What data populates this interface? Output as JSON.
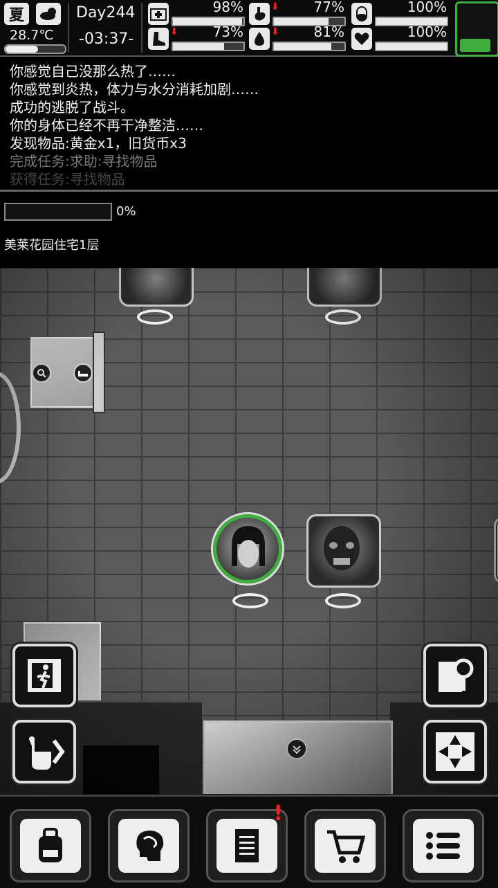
{
  "hud": {
    "season": "夏",
    "temperature": "28.7℃",
    "temperature_level": 0.55,
    "day": "Day244",
    "time": "-03:37-",
    "stats": [
      {
        "name": "health",
        "icon": "medkit-icon",
        "value": "98%",
        "level": 0.98,
        "dropping": false
      },
      {
        "name": "hunger",
        "icon": "stomach-icon",
        "value": "77%",
        "level": 0.77,
        "dropping": true
      },
      {
        "name": "medicine",
        "icon": "pill-icon",
        "value": "100%",
        "level": 1.0,
        "dropping": false
      },
      {
        "name": "stamina",
        "icon": "boot-icon",
        "value": "73%",
        "level": 0.73,
        "dropping": true
      },
      {
        "name": "thirst",
        "icon": "water-drop-icon",
        "value": "81%",
        "level": 0.81,
        "dropping": true
      },
      {
        "name": "mood",
        "icon": "heart-icon",
        "value": "100%",
        "level": 1.0,
        "dropping": false
      }
    ],
    "battery_level": 0.3
  },
  "log": [
    "你感觉自己没那么热了……",
    "你感觉到炎热，体力与水分消耗加剧……",
    "成功的逃脱了战斗。",
    "你的身体已经不再干净整洁……",
    "发现物品:黄金x1，旧货币x3",
    "完成任务:求助:寻找物品",
    "获得任务:寻找物品"
  ],
  "explore": {
    "progress_label": "0%",
    "progress": 0,
    "location": "美莱花园住宅1层"
  },
  "colors": {
    "accent_green": "#3fae3f",
    "alert_red": "#e22222"
  },
  "nav": [
    {
      "name": "backpack",
      "icon": "backpack-icon",
      "badge": false
    },
    {
      "name": "skills",
      "icon": "brain-icon",
      "badge": false
    },
    {
      "name": "quests",
      "icon": "notebook-icon",
      "badge": true
    },
    {
      "name": "shop",
      "icon": "cart-icon",
      "badge": false
    },
    {
      "name": "menu",
      "icon": "menu-list-icon",
      "badge": false
    }
  ]
}
